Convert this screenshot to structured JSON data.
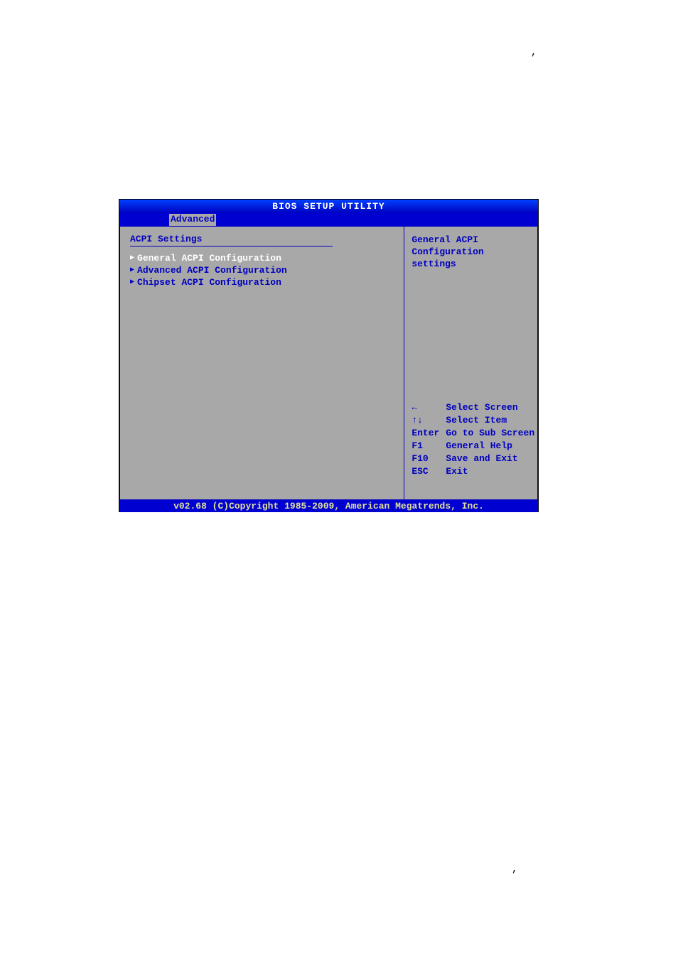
{
  "decorations": {
    "comma1": ",",
    "comma2": ","
  },
  "title": "BIOS SETUP UTILITY",
  "tabs": [
    {
      "label": "Advanced",
      "active": true
    }
  ],
  "left_panel": {
    "section_title": "ACPI Settings",
    "menu_items": [
      {
        "label": "General ACPI Configuration",
        "selected": true
      },
      {
        "label": "Advanced ACPI Configuration",
        "selected": false
      },
      {
        "label": "Chipset ACPI Configuration",
        "selected": false
      }
    ]
  },
  "right_panel": {
    "help_line1": "General ACPI",
    "help_line2": "Configuration settings",
    "keys": [
      {
        "key": "←",
        "action": "Select Screen"
      },
      {
        "key": "↑↓",
        "action": "Select Item"
      },
      {
        "key": "Enter",
        "action": "Go to Sub Screen"
      },
      {
        "key": "F1",
        "action": "General Help"
      },
      {
        "key": "F10",
        "action": "Save and Exit"
      },
      {
        "key": "ESC",
        "action": "Exit"
      }
    ]
  },
  "footer": "v02.68 (C)Copyright 1985-2009, American Megatrends, Inc."
}
